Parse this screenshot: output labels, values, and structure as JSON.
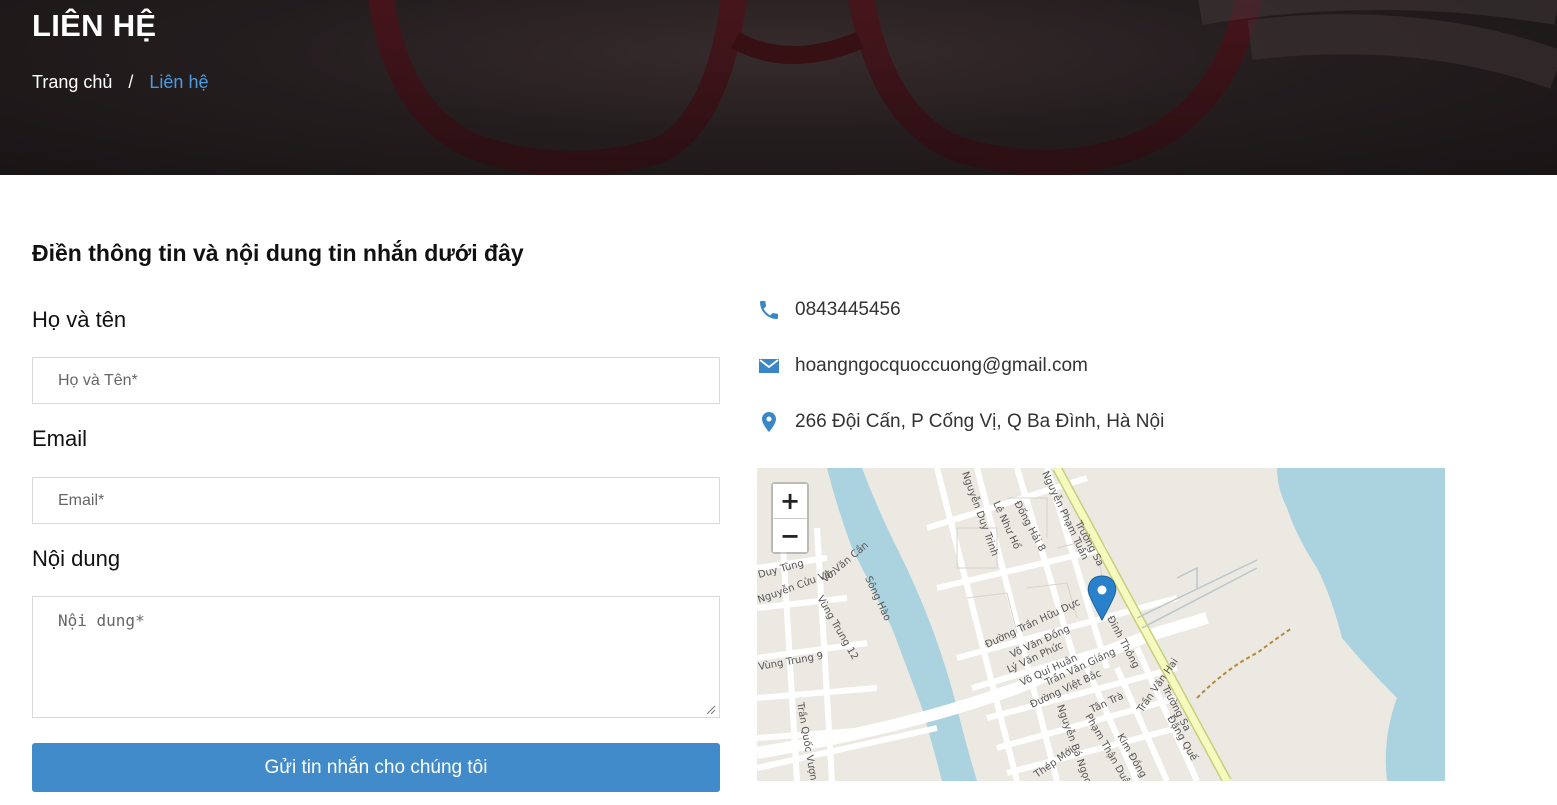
{
  "hero": {
    "title": "LIÊN HỆ",
    "breadcrumb": {
      "home": "Trang chủ",
      "separator": "/",
      "current": "Liên hệ"
    }
  },
  "form": {
    "heading": "Điền thông tin và nội dung tin nhắn dưới đây",
    "name_label": "Họ và tên",
    "name_placeholder": "Họ và Tên*",
    "email_label": "Email",
    "email_placeholder": "Email*",
    "message_label": "Nội dung",
    "message_placeholder": "Nội dung*",
    "submit_label": "Gửi tin nhắn cho chúng tôi"
  },
  "contact": {
    "phone": "0843445456",
    "email": "hoangngocquoccuong@gmail.com",
    "address": "266 Đội Cấn, P Cống Vị, Q Ba Đình, Hà Nội"
  },
  "map": {
    "zoom_in": "+",
    "zoom_out": "−",
    "street_labels": [
      "Trường Sa",
      "Nguyễn Duy Trinh",
      "Lê Như Hổ",
      "Đống Hải 8",
      "Nguyễn Phạm Tuân",
      "Duy Tùng",
      "Nguyễn Cửu Vân",
      "Võ Văn Cần",
      "Vùng Trung 12",
      "Sông Hào",
      "Đường Trần Hữu Dực",
      "Võ Văn Đồng",
      "Lý Văn Phức",
      "Võ Quí Huân",
      "Trần Văn Giáng",
      "Đường Việt Bắc",
      "Đinh Thông",
      "Vùng Trung 9",
      "Trần Quốc Vượng",
      "Tân Trà",
      "Trần Văn Hai",
      "Đặng Quế",
      "Kim Đồng",
      "Phạm Thận Duật",
      "Nguyễn Bá Ngọc",
      "Thép Mới"
    ],
    "colors": {
      "water": "#aad3df",
      "land": "#ece9e2",
      "road": "#ffffff",
      "highway": "#f7fabf",
      "marker": "#2a81cb"
    }
  },
  "colors": {
    "accent": "#428bca",
    "link": "#4b9be0",
    "icon": "#3a87c8"
  }
}
